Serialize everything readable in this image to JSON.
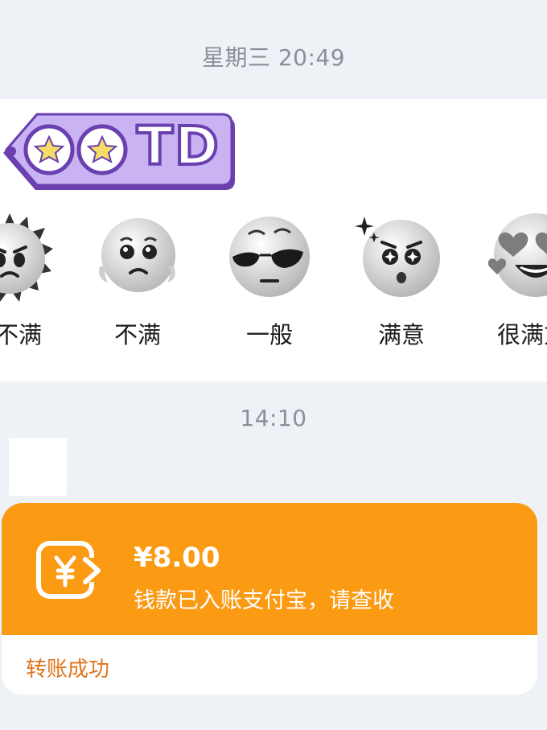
{
  "messages": {
    "timestamp_1": "星期三 20:49",
    "timestamp_2": "14:10"
  },
  "rating_card": {
    "tag_text": "TD",
    "tag_color": "#c9b3f2",
    "tag_border_color": "#6a3fb0",
    "star_color": "#f6dd63",
    "options": [
      {
        "label": "非常不满",
        "visible_label": "不满",
        "icon": "angry-face-icon"
      },
      {
        "label": "不满",
        "icon": "crying-face-icon"
      },
      {
        "label": "一般",
        "icon": "sunglasses-face-icon"
      },
      {
        "label": "满意",
        "icon": "sparkle-eyes-face-icon"
      },
      {
        "label": "很满意",
        "visible_label": "很满方",
        "icon": "heart-eyes-face-icon"
      }
    ]
  },
  "transfer": {
    "amount": "¥8.00",
    "description": "钱款已入账支付宝，请查收",
    "status": "转账成功",
    "accent_color": "#fb9a13",
    "status_color": "#e0741b",
    "icon": "transfer-yuan-icon"
  }
}
